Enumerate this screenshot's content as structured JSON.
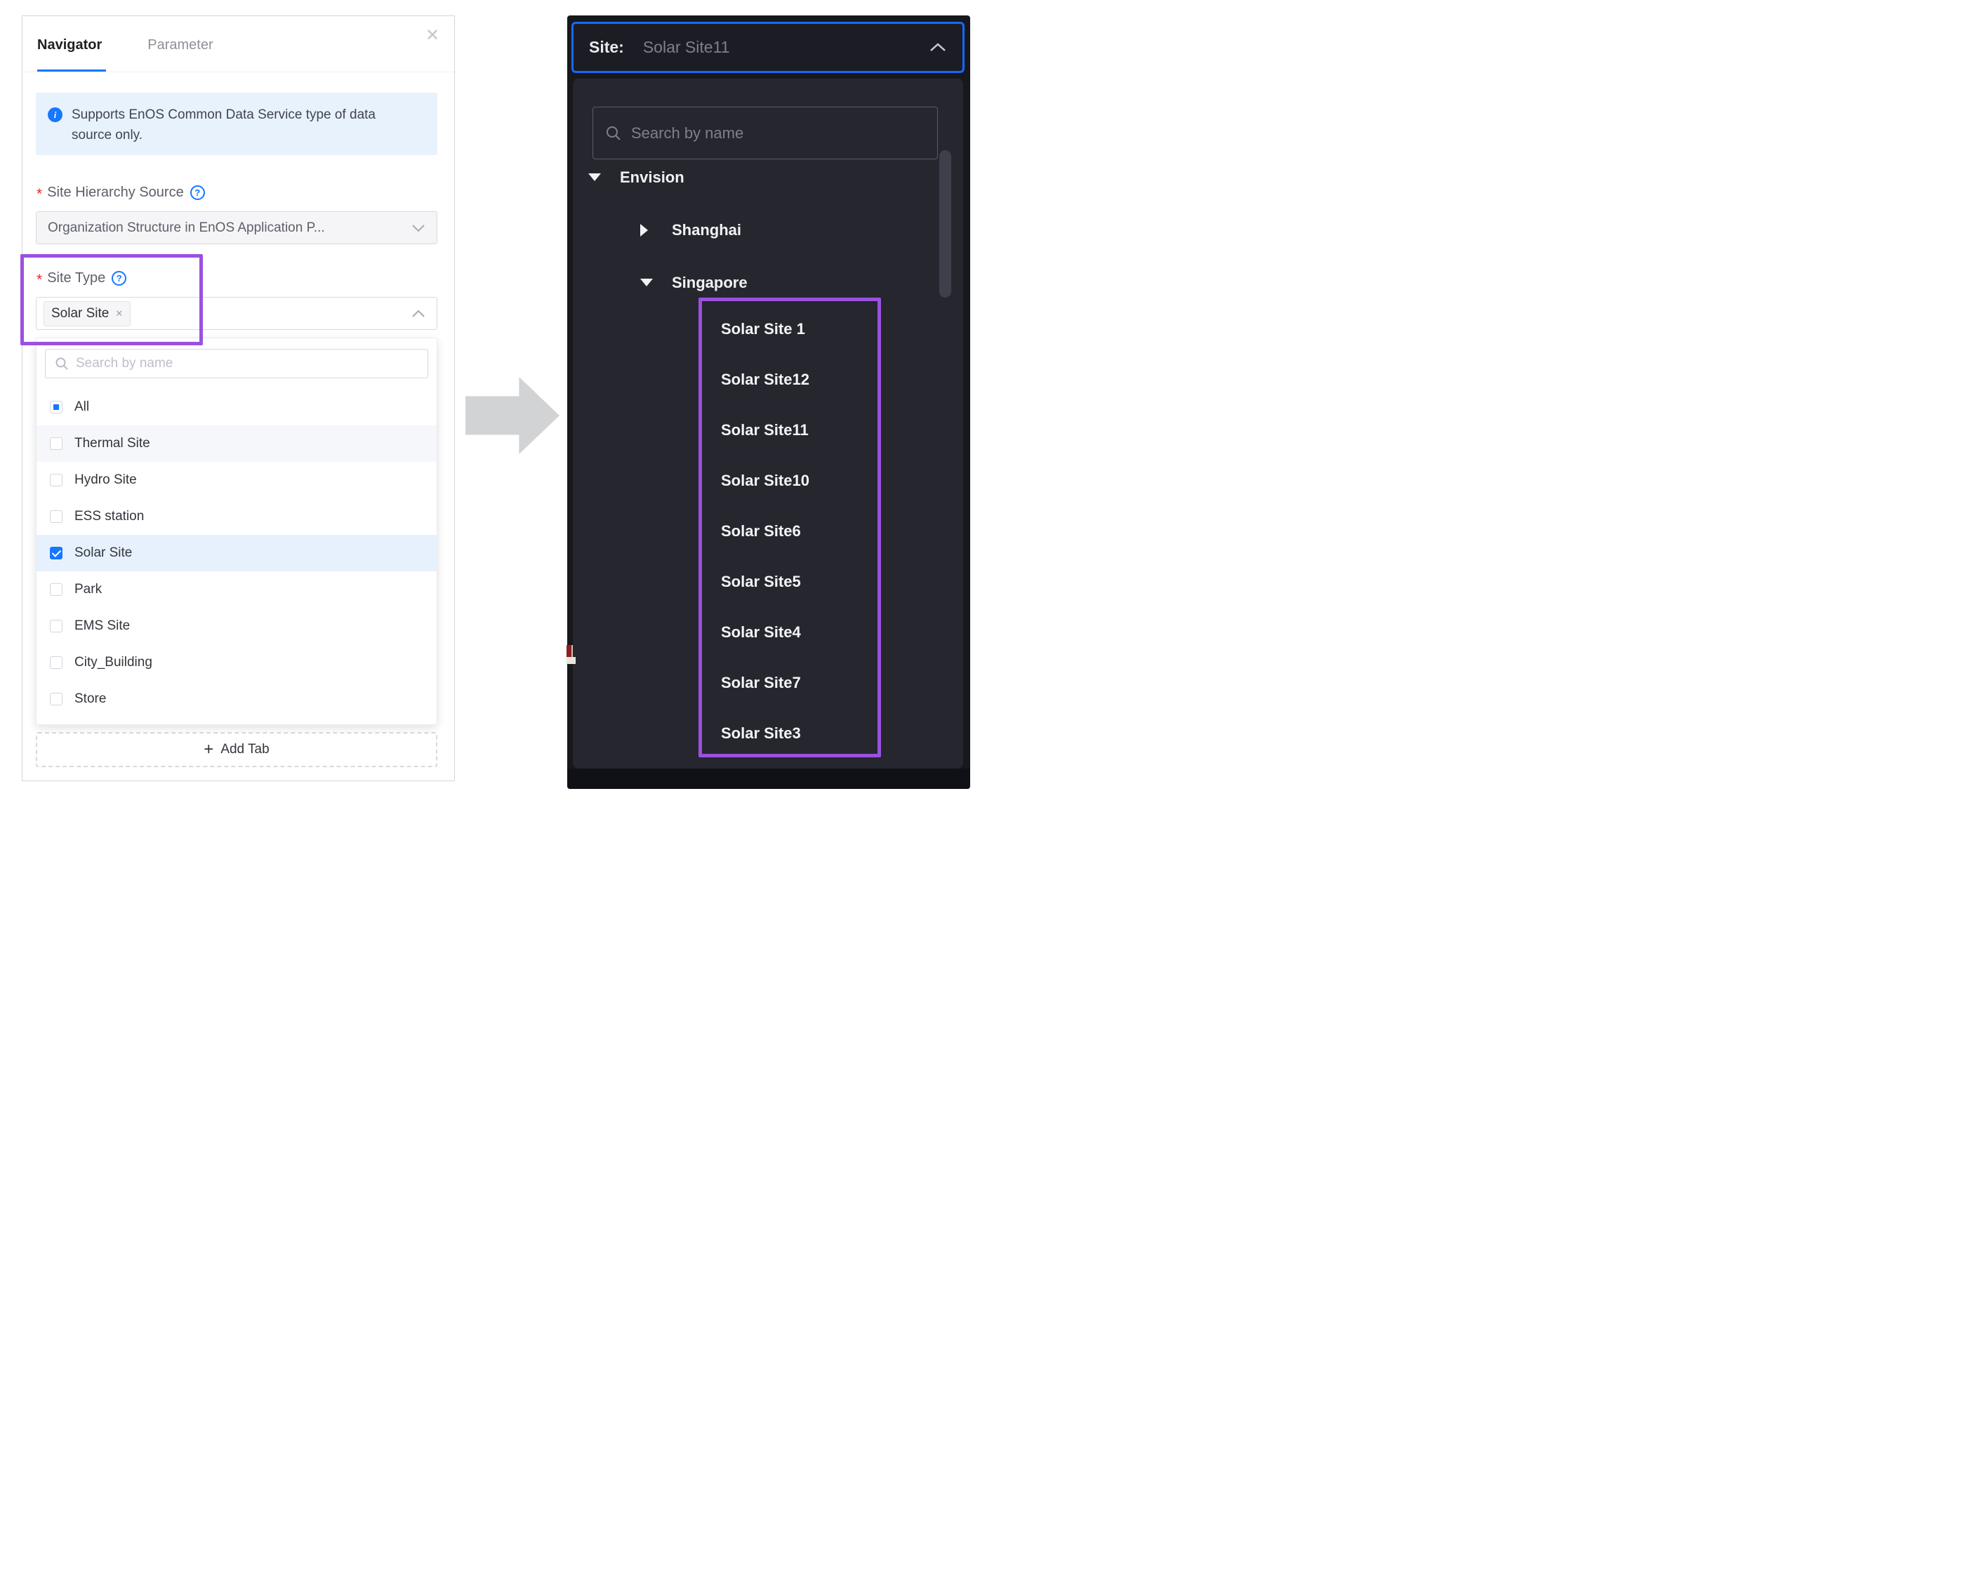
{
  "left_panel": {
    "tabs": [
      {
        "label": "Navigator",
        "active": true
      },
      {
        "label": "Parameter",
        "active": false
      }
    ],
    "info_banner": {
      "icon": "info-circle-icon",
      "text": "Supports EnOS Common Data Service type of data source only."
    },
    "fields": [
      {
        "label": "Site Hierarchy Source",
        "required": true,
        "help_icon": "question-circle-icon",
        "value": "Organization Structure in EnOS Application P...",
        "state": "collapsed"
      },
      {
        "label": "Site Type",
        "required": true,
        "help_icon": "question-circle-icon",
        "selected_tag": "Solar Site",
        "state": "expanded"
      }
    ],
    "type_dropdown": {
      "search_placeholder": "Search by name",
      "options": [
        {
          "label": "All",
          "checkbox": "indeterminate"
        },
        {
          "label": "Thermal Site",
          "checkbox": "unchecked",
          "hovered": true
        },
        {
          "label": "Hydro Site",
          "checkbox": "unchecked"
        },
        {
          "label": "ESS station",
          "checkbox": "unchecked"
        },
        {
          "label": "Solar Site",
          "checkbox": "checked",
          "selected": true
        },
        {
          "label": "Park",
          "checkbox": "unchecked"
        },
        {
          "label": "EMS Site",
          "checkbox": "unchecked"
        },
        {
          "label": "City_Building",
          "checkbox": "unchecked"
        },
        {
          "label": "Store",
          "checkbox": "unchecked"
        }
      ]
    },
    "add_tab_label": "Add Tab"
  },
  "arrow": {
    "direction": "right",
    "color": "#d2d3d5"
  },
  "right_panel": {
    "header": {
      "label": "Site:",
      "value": "Solar Site11",
      "state": "expanded"
    },
    "search_placeholder": "Search by name",
    "tree": [
      {
        "label": "Envision",
        "level": 0,
        "expanded": true
      },
      {
        "label": "Shanghai",
        "level": 1,
        "expanded": false
      },
      {
        "label": "Singapore",
        "level": 1,
        "expanded": true
      }
    ],
    "sites": [
      "Solar Site 1",
      "Solar Site12",
      "Solar Site11",
      "Solar Site10",
      "Solar Site6",
      "Solar Site5",
      "Solar Site4",
      "Solar Site7",
      "Solar Site3"
    ]
  },
  "colors": {
    "accent_blue": "#1677ff",
    "header_border_blue": "#1668ff",
    "highlight_purple": "#9b51e0",
    "info_background": "#e8f2fd",
    "selected_row": "#e7f1fd",
    "dark_background": "#17181d",
    "dark_panel": "#26262e",
    "arrow_gray": "#d2d3d5"
  }
}
